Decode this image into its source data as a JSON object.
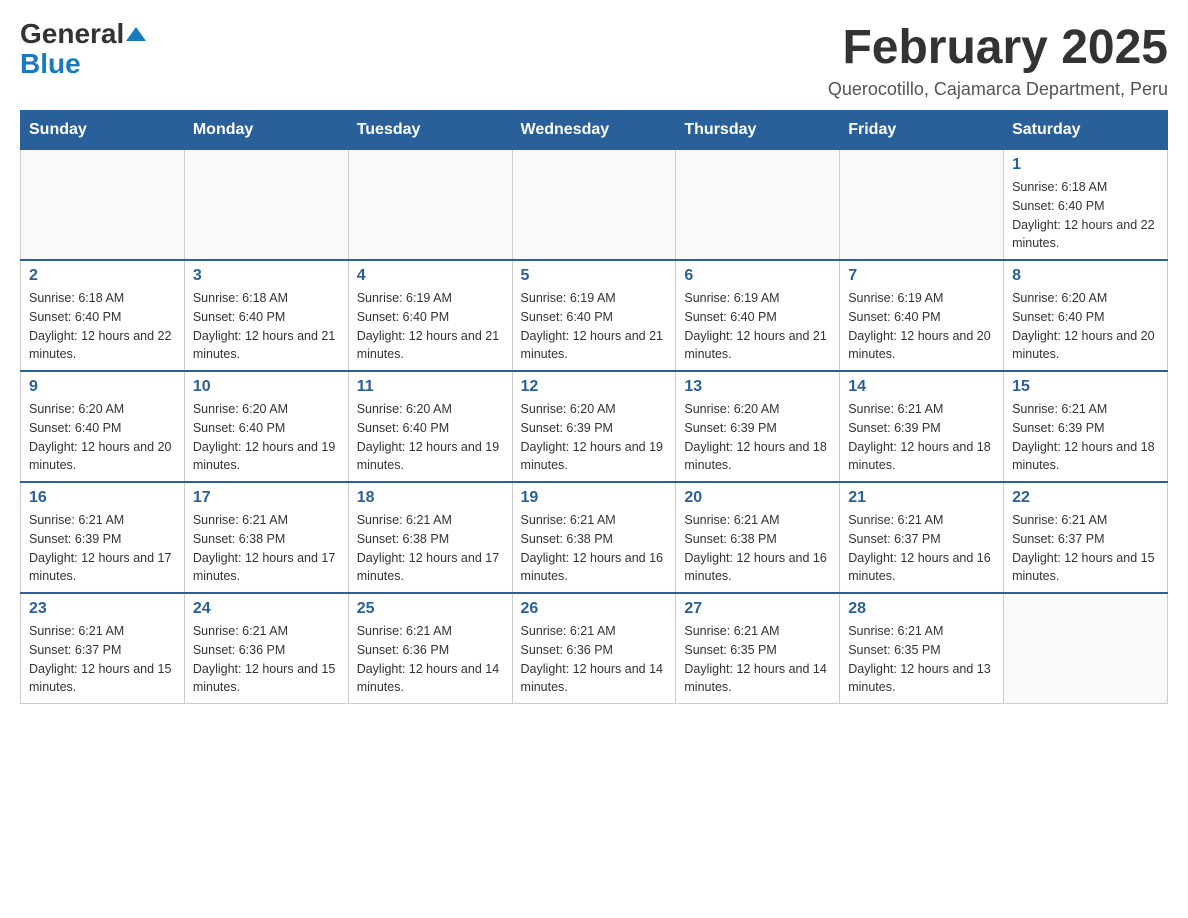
{
  "header": {
    "logo_general": "General",
    "logo_blue": "Blue",
    "month_title": "February 2025",
    "subtitle": "Querocotillo, Cajamarca Department, Peru"
  },
  "days_of_week": [
    "Sunday",
    "Monday",
    "Tuesday",
    "Wednesday",
    "Thursday",
    "Friday",
    "Saturday"
  ],
  "weeks": [
    [
      {
        "day": "",
        "info": ""
      },
      {
        "day": "",
        "info": ""
      },
      {
        "day": "",
        "info": ""
      },
      {
        "day": "",
        "info": ""
      },
      {
        "day": "",
        "info": ""
      },
      {
        "day": "",
        "info": ""
      },
      {
        "day": "1",
        "info": "Sunrise: 6:18 AM\nSunset: 6:40 PM\nDaylight: 12 hours and 22 minutes."
      }
    ],
    [
      {
        "day": "2",
        "info": "Sunrise: 6:18 AM\nSunset: 6:40 PM\nDaylight: 12 hours and 22 minutes."
      },
      {
        "day": "3",
        "info": "Sunrise: 6:18 AM\nSunset: 6:40 PM\nDaylight: 12 hours and 21 minutes."
      },
      {
        "day": "4",
        "info": "Sunrise: 6:19 AM\nSunset: 6:40 PM\nDaylight: 12 hours and 21 minutes."
      },
      {
        "day": "5",
        "info": "Sunrise: 6:19 AM\nSunset: 6:40 PM\nDaylight: 12 hours and 21 minutes."
      },
      {
        "day": "6",
        "info": "Sunrise: 6:19 AM\nSunset: 6:40 PM\nDaylight: 12 hours and 21 minutes."
      },
      {
        "day": "7",
        "info": "Sunrise: 6:19 AM\nSunset: 6:40 PM\nDaylight: 12 hours and 20 minutes."
      },
      {
        "day": "8",
        "info": "Sunrise: 6:20 AM\nSunset: 6:40 PM\nDaylight: 12 hours and 20 minutes."
      }
    ],
    [
      {
        "day": "9",
        "info": "Sunrise: 6:20 AM\nSunset: 6:40 PM\nDaylight: 12 hours and 20 minutes."
      },
      {
        "day": "10",
        "info": "Sunrise: 6:20 AM\nSunset: 6:40 PM\nDaylight: 12 hours and 19 minutes."
      },
      {
        "day": "11",
        "info": "Sunrise: 6:20 AM\nSunset: 6:40 PM\nDaylight: 12 hours and 19 minutes."
      },
      {
        "day": "12",
        "info": "Sunrise: 6:20 AM\nSunset: 6:39 PM\nDaylight: 12 hours and 19 minutes."
      },
      {
        "day": "13",
        "info": "Sunrise: 6:20 AM\nSunset: 6:39 PM\nDaylight: 12 hours and 18 minutes."
      },
      {
        "day": "14",
        "info": "Sunrise: 6:21 AM\nSunset: 6:39 PM\nDaylight: 12 hours and 18 minutes."
      },
      {
        "day": "15",
        "info": "Sunrise: 6:21 AM\nSunset: 6:39 PM\nDaylight: 12 hours and 18 minutes."
      }
    ],
    [
      {
        "day": "16",
        "info": "Sunrise: 6:21 AM\nSunset: 6:39 PM\nDaylight: 12 hours and 17 minutes."
      },
      {
        "day": "17",
        "info": "Sunrise: 6:21 AM\nSunset: 6:38 PM\nDaylight: 12 hours and 17 minutes."
      },
      {
        "day": "18",
        "info": "Sunrise: 6:21 AM\nSunset: 6:38 PM\nDaylight: 12 hours and 17 minutes."
      },
      {
        "day": "19",
        "info": "Sunrise: 6:21 AM\nSunset: 6:38 PM\nDaylight: 12 hours and 16 minutes."
      },
      {
        "day": "20",
        "info": "Sunrise: 6:21 AM\nSunset: 6:38 PM\nDaylight: 12 hours and 16 minutes."
      },
      {
        "day": "21",
        "info": "Sunrise: 6:21 AM\nSunset: 6:37 PM\nDaylight: 12 hours and 16 minutes."
      },
      {
        "day": "22",
        "info": "Sunrise: 6:21 AM\nSunset: 6:37 PM\nDaylight: 12 hours and 15 minutes."
      }
    ],
    [
      {
        "day": "23",
        "info": "Sunrise: 6:21 AM\nSunset: 6:37 PM\nDaylight: 12 hours and 15 minutes."
      },
      {
        "day": "24",
        "info": "Sunrise: 6:21 AM\nSunset: 6:36 PM\nDaylight: 12 hours and 15 minutes."
      },
      {
        "day": "25",
        "info": "Sunrise: 6:21 AM\nSunset: 6:36 PM\nDaylight: 12 hours and 14 minutes."
      },
      {
        "day": "26",
        "info": "Sunrise: 6:21 AM\nSunset: 6:36 PM\nDaylight: 12 hours and 14 minutes."
      },
      {
        "day": "27",
        "info": "Sunrise: 6:21 AM\nSunset: 6:35 PM\nDaylight: 12 hours and 14 minutes."
      },
      {
        "day": "28",
        "info": "Sunrise: 6:21 AM\nSunset: 6:35 PM\nDaylight: 12 hours and 13 minutes."
      },
      {
        "day": "",
        "info": ""
      }
    ]
  ]
}
